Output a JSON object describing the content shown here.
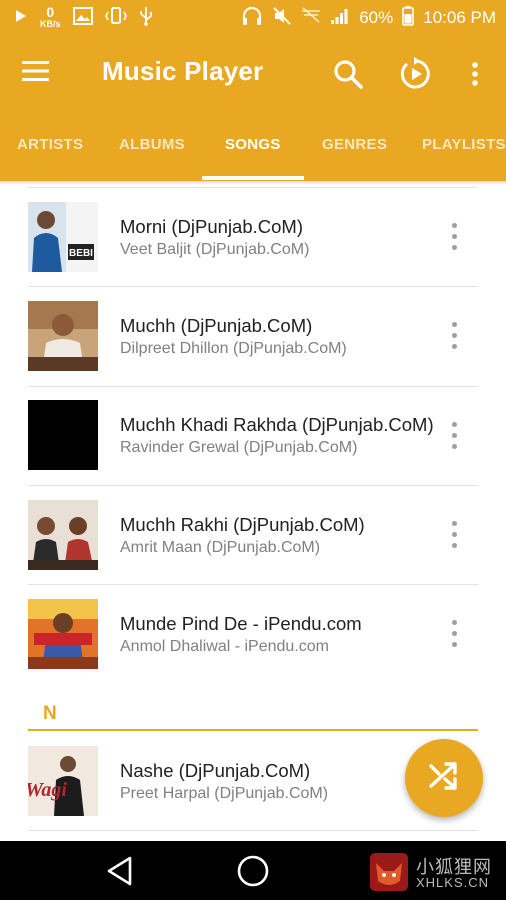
{
  "status_bar": {
    "speed_value": "0",
    "speed_unit": "KB/s",
    "battery_percent": "60%",
    "time": "10:06 PM",
    "icons": [
      "play-icon",
      "image-icon",
      "vibrate-icon",
      "usb-icon",
      "headphones-icon",
      "mute-icon",
      "no-signal-icon",
      "signal-icon",
      "battery-icon"
    ]
  },
  "app_bar": {
    "title": "Music Player",
    "actions": [
      "search-icon",
      "playback-icon",
      "overflow-menu-icon"
    ]
  },
  "tabs": [
    {
      "label": "ARTISTS",
      "active": false
    },
    {
      "label": "ALBUMS",
      "active": false
    },
    {
      "label": "SONGS",
      "active": true
    },
    {
      "label": "GENRES",
      "active": false
    },
    {
      "label": "PLAYLISTS",
      "active": false
    }
  ],
  "songs": [
    {
      "title": "Morni (DjPunjab.CoM)",
      "artist": "Veet Baljit (DjPunjab.CoM)"
    },
    {
      "title": "Muchh (DjPunjab.CoM)",
      "artist": "Dilpreet Dhillon (DjPunjab.CoM)"
    },
    {
      "title": "Muchh Khadi Rakhda (DjPunjab.CoM)",
      "artist": "Ravinder Grewal (DjPunjab.CoM)"
    },
    {
      "title": "Muchh Rakhi (DjPunjab.CoM)",
      "artist": "Amrit Maan (DjPunjab.CoM)"
    },
    {
      "title": "Munde Pind De - iPendu.com",
      "artist": "Anmol Dhaliwal - iPendu.com"
    }
  ],
  "section": {
    "letter": "N"
  },
  "songs_n": [
    {
      "title": "Nashe (DjPunjab.CoM)",
      "artist": "Preet Harpal (DjPunjab.CoM)"
    }
  ],
  "fab": {
    "icon": "shuffle-icon"
  },
  "watermark": {
    "line1": "小狐狸网",
    "line2": "XHLKS.CN"
  },
  "colors": {
    "accent": "#E9A822",
    "title_text": "#212121",
    "subtitle_text": "#808080"
  }
}
